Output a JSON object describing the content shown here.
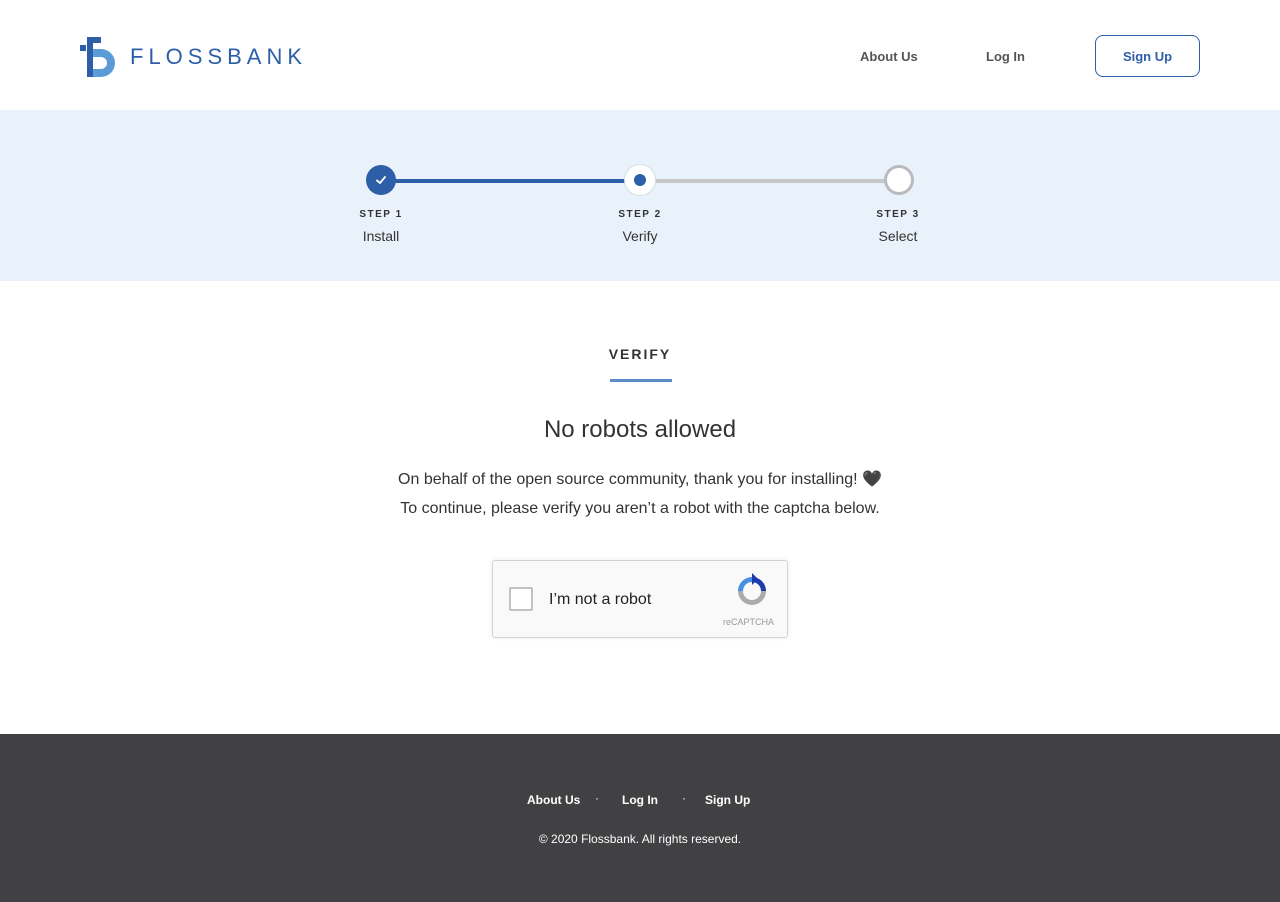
{
  "header": {
    "logo_text": "FLOSSBANK",
    "nav": {
      "about": "About Us",
      "login": "Log In",
      "signup": "Sign Up"
    }
  },
  "stepper": {
    "current_step": 2,
    "steps": [
      {
        "label": "STEP 1",
        "name": "Install",
        "state": "complete",
        "icon": "check-icon"
      },
      {
        "label": "STEP 2",
        "name": "Verify",
        "state": "current"
      },
      {
        "label": "STEP 3",
        "name": "Select",
        "state": "pending"
      }
    ]
  },
  "main": {
    "section_title": "VERIFY",
    "headline": "No robots allowed",
    "line1": "On behalf of the open source community, thank you for installing! 🖤",
    "line2": "To continue, please verify you aren’t a robot with the captcha below."
  },
  "captcha": {
    "label": "I’m not a robot",
    "brand": "reCAPTCHA",
    "checked": false
  },
  "footer": {
    "links": {
      "about": "About Us",
      "login": "Log In",
      "signup": "Sign Up"
    },
    "separator": "·",
    "copyright": "© 2020 Flossbank. All rights reserved."
  },
  "colors": {
    "brand": "#2c5fa8",
    "stepper_bg": "#e9f1fa",
    "footer_bg": "#414143",
    "track_inactive": "#c5c7ca"
  }
}
